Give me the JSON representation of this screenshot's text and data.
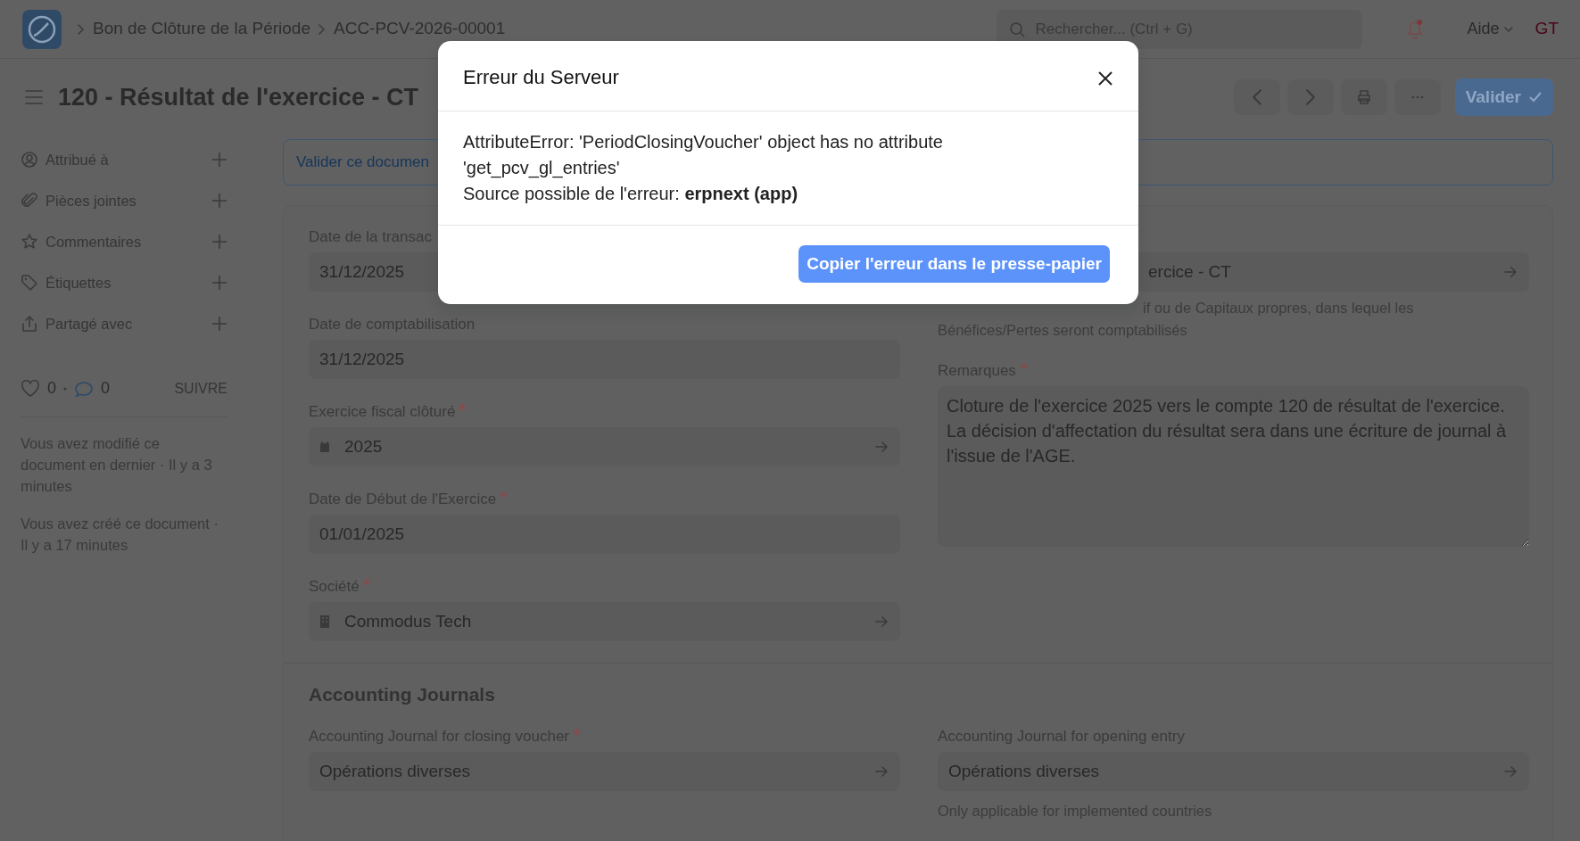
{
  "topbar": {
    "breadcrumbs": [
      "Bon de Clôture de la Période",
      "ACC-PCV-2026-00001"
    ],
    "search": {
      "placeholder": "Rechercher... (Ctrl + G)"
    },
    "help_menu": "Aide",
    "avatar": "GT"
  },
  "page": {
    "title": "120 - Résultat de l'exercice - CT",
    "primary_action": "Valider"
  },
  "sidebar": {
    "items": [
      {
        "kind": "assign",
        "label": "Attribué à"
      },
      {
        "kind": "attach",
        "label": "Pièces jointes"
      },
      {
        "kind": "comment",
        "label": "Commentaires"
      },
      {
        "kind": "tag",
        "label": "Étiquettes"
      },
      {
        "kind": "share",
        "label": "Partagé avec"
      }
    ],
    "likes": "0",
    "comments": "0",
    "follow": "SUIVRE",
    "activity": [
      "Vous avez modifié ce document en dernier · Il y a 3 minutes",
      "Vous avez créé ce document · Il y a 17 minutes"
    ]
  },
  "alert": "Valider ce documen",
  "form": {
    "left_fields": [
      {
        "kind": "date",
        "label": "Date de la transac",
        "required": false,
        "value": "31/12/2025"
      },
      {
        "kind": "date",
        "label": "Date de comptabilisation",
        "required": false,
        "value": "31/12/2025"
      },
      {
        "kind": "year_link",
        "label": "Exercice fiscal clôturé",
        "required": true,
        "value": "2025"
      },
      {
        "kind": "date",
        "label": "Date de Début de l'Exercice",
        "required": true,
        "value": "01/01/2025"
      },
      {
        "kind": "company_link",
        "label": "Société",
        "required": true,
        "value": "Commodus Tech"
      }
    ],
    "account_field": {
      "value": "ercice - CT",
      "description": [
        "if ou de Capitaux propres, dans lequel les",
        "Bénéfices/Pertes seront comptabilisés"
      ]
    },
    "remarks": {
      "label": "Remarques",
      "required": true,
      "value": "Cloture de l'exercice 2025 vers le compte 120 de résultat de l'exercice.\nLa décision d'affectation du résultat sera dans une écriture de journal à l'issue de l'AGE."
    }
  },
  "journals": {
    "title": "Accounting Journals",
    "fields": [
      {
        "label": "Accounting Journal for closing voucher",
        "required": true,
        "value": "Opérations diverses"
      },
      {
        "label": "Accounting Journal for opening entry",
        "required": false,
        "value": "Opérations diverses",
        "description": "Only applicable for implemented countries"
      }
    ]
  },
  "modal": {
    "title": "Erreur du Serveur",
    "message": [
      "AttributeError: 'PeriodClosingVoucher' object has no attribute 'get_pcv_gl_entries'",
      "Source possible de l'erreur: **erpnext (app)**"
    ],
    "button": "Copier l'erreur dans le presse-papier"
  }
}
